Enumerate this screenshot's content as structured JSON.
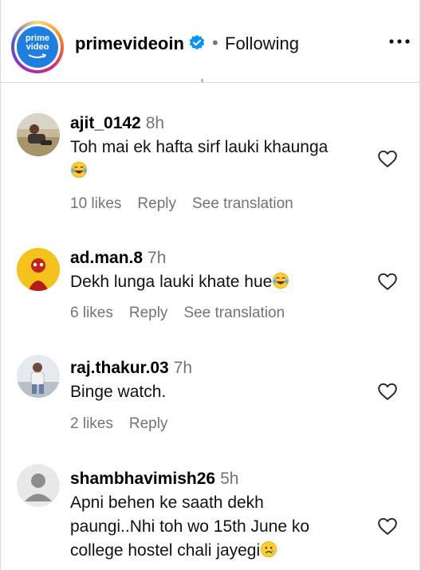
{
  "header": {
    "logo_text_line1": "prime",
    "logo_text_line2": "video",
    "username": "primevideoin",
    "separator": "•",
    "follow_status": "Following",
    "more_icon": "more-horizontal-icon"
  },
  "comments": [
    {
      "username": "ajit_0142",
      "time": "8h",
      "text_line1": "Toh mai ek hafta sirf lauki khaunga",
      "text_line2": "",
      "text_line3": "",
      "emoji": "face-with-tears-of-joy",
      "likes": "10 likes",
      "reply": "Reply",
      "translate": "See translation"
    },
    {
      "username": "ad.man.8",
      "time": "7h",
      "text_line1": "Dekh lunga lauki khate hue",
      "emoji": "face-with-tears-of-joy",
      "likes": "6 likes",
      "reply": "Reply",
      "translate": "See translation"
    },
    {
      "username": "raj.thakur.03",
      "time": "7h",
      "text_line1": "Binge watch.",
      "likes": "2 likes",
      "reply": "Reply"
    },
    {
      "username": "shambhavimish26",
      "time": "5h",
      "text_line1": "Apni behen ke saath dekh",
      "text_line2": "paungi..Nhi toh wo 15th June ko",
      "text_line3": "college hostel chali jayegi",
      "emoji": "sad-face"
    }
  ],
  "colors": {
    "accent_blue": "#1f7fe0",
    "verified_blue": "#0095f6",
    "muted_text": "#737373",
    "divider": "#dbdbdb"
  }
}
